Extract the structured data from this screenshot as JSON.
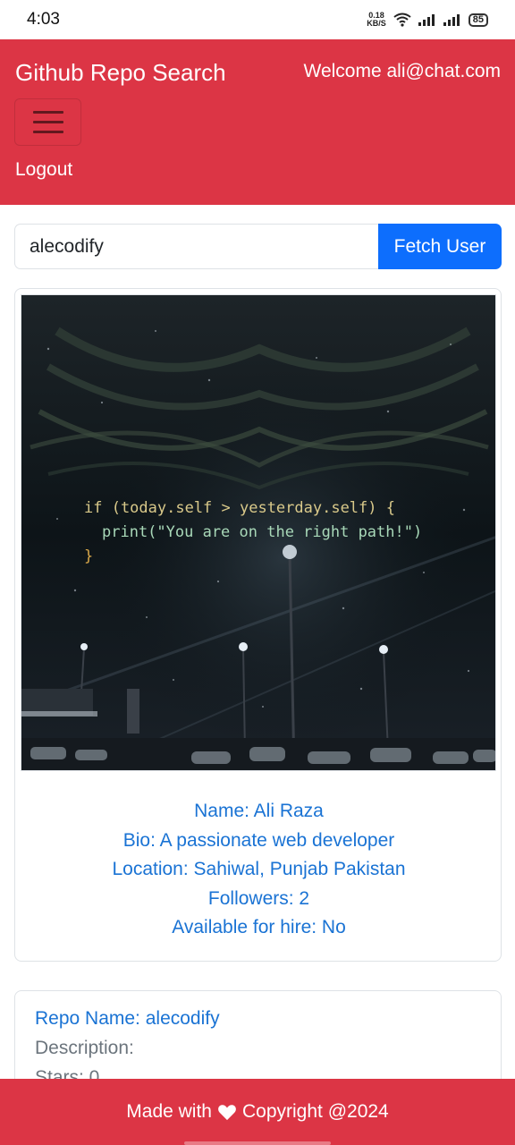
{
  "status_bar": {
    "time": "4:03",
    "net_speed_value": "0.18",
    "net_speed_unit": "KB/S",
    "battery": "85"
  },
  "navbar": {
    "brand": "Github Repo Search",
    "welcome": "Welcome ali@chat.com",
    "logout": "Logout"
  },
  "search": {
    "value": "alecodify",
    "button_label": "Fetch User"
  },
  "profile": {
    "avatar_code_line1": "if (today.self > yesterday.self) {",
    "avatar_code_line2": "print(\"You are on the right path!\")",
    "avatar_code_line3": "}",
    "name": "Name: Ali Raza",
    "bio": "Bio: A passionate web developer",
    "location": "Location: Sahiwal, Punjab Pakistan",
    "followers": "Followers: 2",
    "hire": "Available for hire: No"
  },
  "repo": {
    "name": "Repo Name: alecodify",
    "description": "Description:",
    "stars": "Stars: 0"
  },
  "footer": {
    "made_with": "Made with",
    "copyright": "Copyright @2024"
  },
  "colors": {
    "brand_red": "#dc3545",
    "primary_blue": "#0d6efd",
    "link_blue": "#1a73d4"
  }
}
